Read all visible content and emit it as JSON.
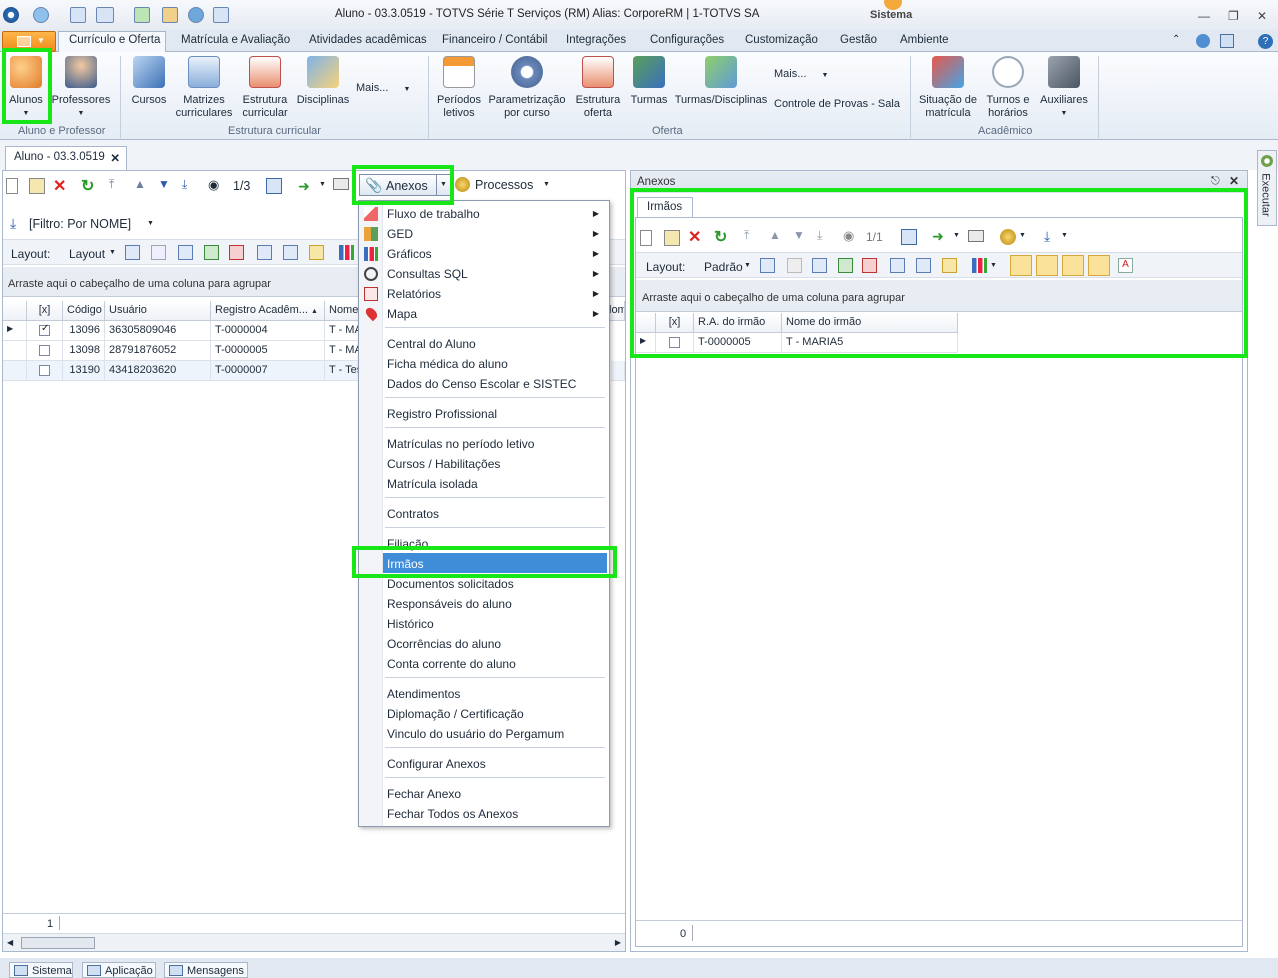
{
  "window": {
    "title": "Aluno - 03.3.0519 - TOTVS Série T Serviços (RM) Alias: CorporeRM | 1-TOTVS SA",
    "system_label": "Sistema"
  },
  "ribbon_tabs": [
    "Currículo e Oferta",
    "Matrícula e Avaliação",
    "Atividades acadêmicas",
    "Financeiro / Contábil",
    "Integrações",
    "Configurações",
    "Customização",
    "Gestão",
    "Ambiente"
  ],
  "ribbon": {
    "groups": [
      "Aluno e Professor",
      "Estrutura curricular",
      "Oferta",
      "Acadêmico"
    ],
    "buttons": {
      "alunos": "Alunos",
      "professores": "Professores",
      "cursos": "Cursos",
      "matrizes1": "Matrizes",
      "matrizes2": "curriculares",
      "estrutura1": "Estrutura",
      "estrutura2": "curricular",
      "disciplinas": "Disciplinas",
      "mais1": "Mais...",
      "periodos1": "Períodos",
      "periodos2": "letivos",
      "param1": "Parametrização",
      "param2": "por curso",
      "eoferta1": "Estrutura",
      "eoferta2": "oferta",
      "turmas": "Turmas",
      "turmasdisc": "Turmas/Disciplinas",
      "mais2": "Mais...",
      "provas": "Controle de Provas - Sala",
      "situacao1": "Situação de",
      "situacao2": "matrícula",
      "turnos1": "Turnos e",
      "turnos2": "horários",
      "auxiliares": "Auxiliares"
    }
  },
  "doc_tab": "Aluno - 03.3.0519",
  "left": {
    "toolbar": {
      "page": "1/3",
      "anexos": "Anexos",
      "processos": "Processos"
    },
    "filter": "[Filtro: Por NOME]",
    "layout_label": "Layout:",
    "layout_btn": "Layout",
    "group_hint": "Arraste aqui o cabeçalho de uma coluna para agrupar",
    "columns": [
      "[x]",
      "Código",
      "Usuário",
      "Registro Acadêm...",
      "Nome",
      "lome"
    ],
    "rows": [
      {
        "checked": true,
        "codigo": "13096",
        "usuario": "36305809046",
        "registro": "T-0000004",
        "nome": "T - MA"
      },
      {
        "checked": false,
        "codigo": "13098",
        "usuario": "28791876052",
        "registro": "T-0000005",
        "nome": "T - MA"
      },
      {
        "checked": false,
        "codigo": "13190",
        "usuario": "43418203620",
        "registro": "T-0000007",
        "nome": "T - Tes"
      }
    ],
    "footer_count": "1"
  },
  "menu": {
    "items": [
      {
        "label": "Fluxo de trabalho",
        "sub": true
      },
      {
        "label": "GED",
        "sub": true
      },
      {
        "label": "Gráficos",
        "sub": true
      },
      {
        "label": "Consultas SQL",
        "sub": true
      },
      {
        "label": "Relatórios",
        "sub": true
      },
      {
        "label": "Mapa",
        "sub": true
      },
      {
        "label": "Central do Aluno"
      },
      {
        "label": "Ficha médica do aluno"
      },
      {
        "label": "Dados do Censo Escolar e SISTEC"
      },
      {
        "label": "Registro Profissional"
      },
      {
        "label": "Matrículas no período letivo"
      },
      {
        "label": "Cursos / Habilitações"
      },
      {
        "label": "Matrícula isolada"
      },
      {
        "label": "Contratos"
      },
      {
        "label": "Filiação"
      },
      {
        "label": "Irmãos",
        "highlighted": true
      },
      {
        "label": "Documentos solicitados"
      },
      {
        "label": "Responsáveis do aluno"
      },
      {
        "label": "Histórico"
      },
      {
        "label": "Ocorrências do aluno"
      },
      {
        "label": "Conta corrente do aluno"
      },
      {
        "label": "Atendimentos"
      },
      {
        "label": "Diplomação / Certificação"
      },
      {
        "label": "Vinculo do usuário do Pergamum"
      },
      {
        "label": "Configurar Anexos"
      },
      {
        "label": "Fechar Anexo"
      },
      {
        "label": "Fechar Todos os Anexos"
      }
    ]
  },
  "right": {
    "panel_title": "Anexos",
    "tab": "Irmãos",
    "page": "1/1",
    "layout_label": "Layout:",
    "layout_btn": "Padrão",
    "group_hint": "Arraste aqui o cabeçalho de uma coluna para agrupar",
    "columns": [
      "[x]",
      "R.A. do irmão",
      "Nome do irmão"
    ],
    "rows": [
      {
        "checked": false,
        "ra": "T-0000005",
        "nome": "T - MARIA5"
      }
    ],
    "footer_count": "0"
  },
  "side_tab": "Executar",
  "bottom_tabs": [
    "Sistema",
    "Aplicação",
    "Mensagens"
  ],
  "colors": {
    "highlight": "#17e617",
    "menu_highlight": "#3f8cd9",
    "file_menu": "#f08a1c"
  }
}
